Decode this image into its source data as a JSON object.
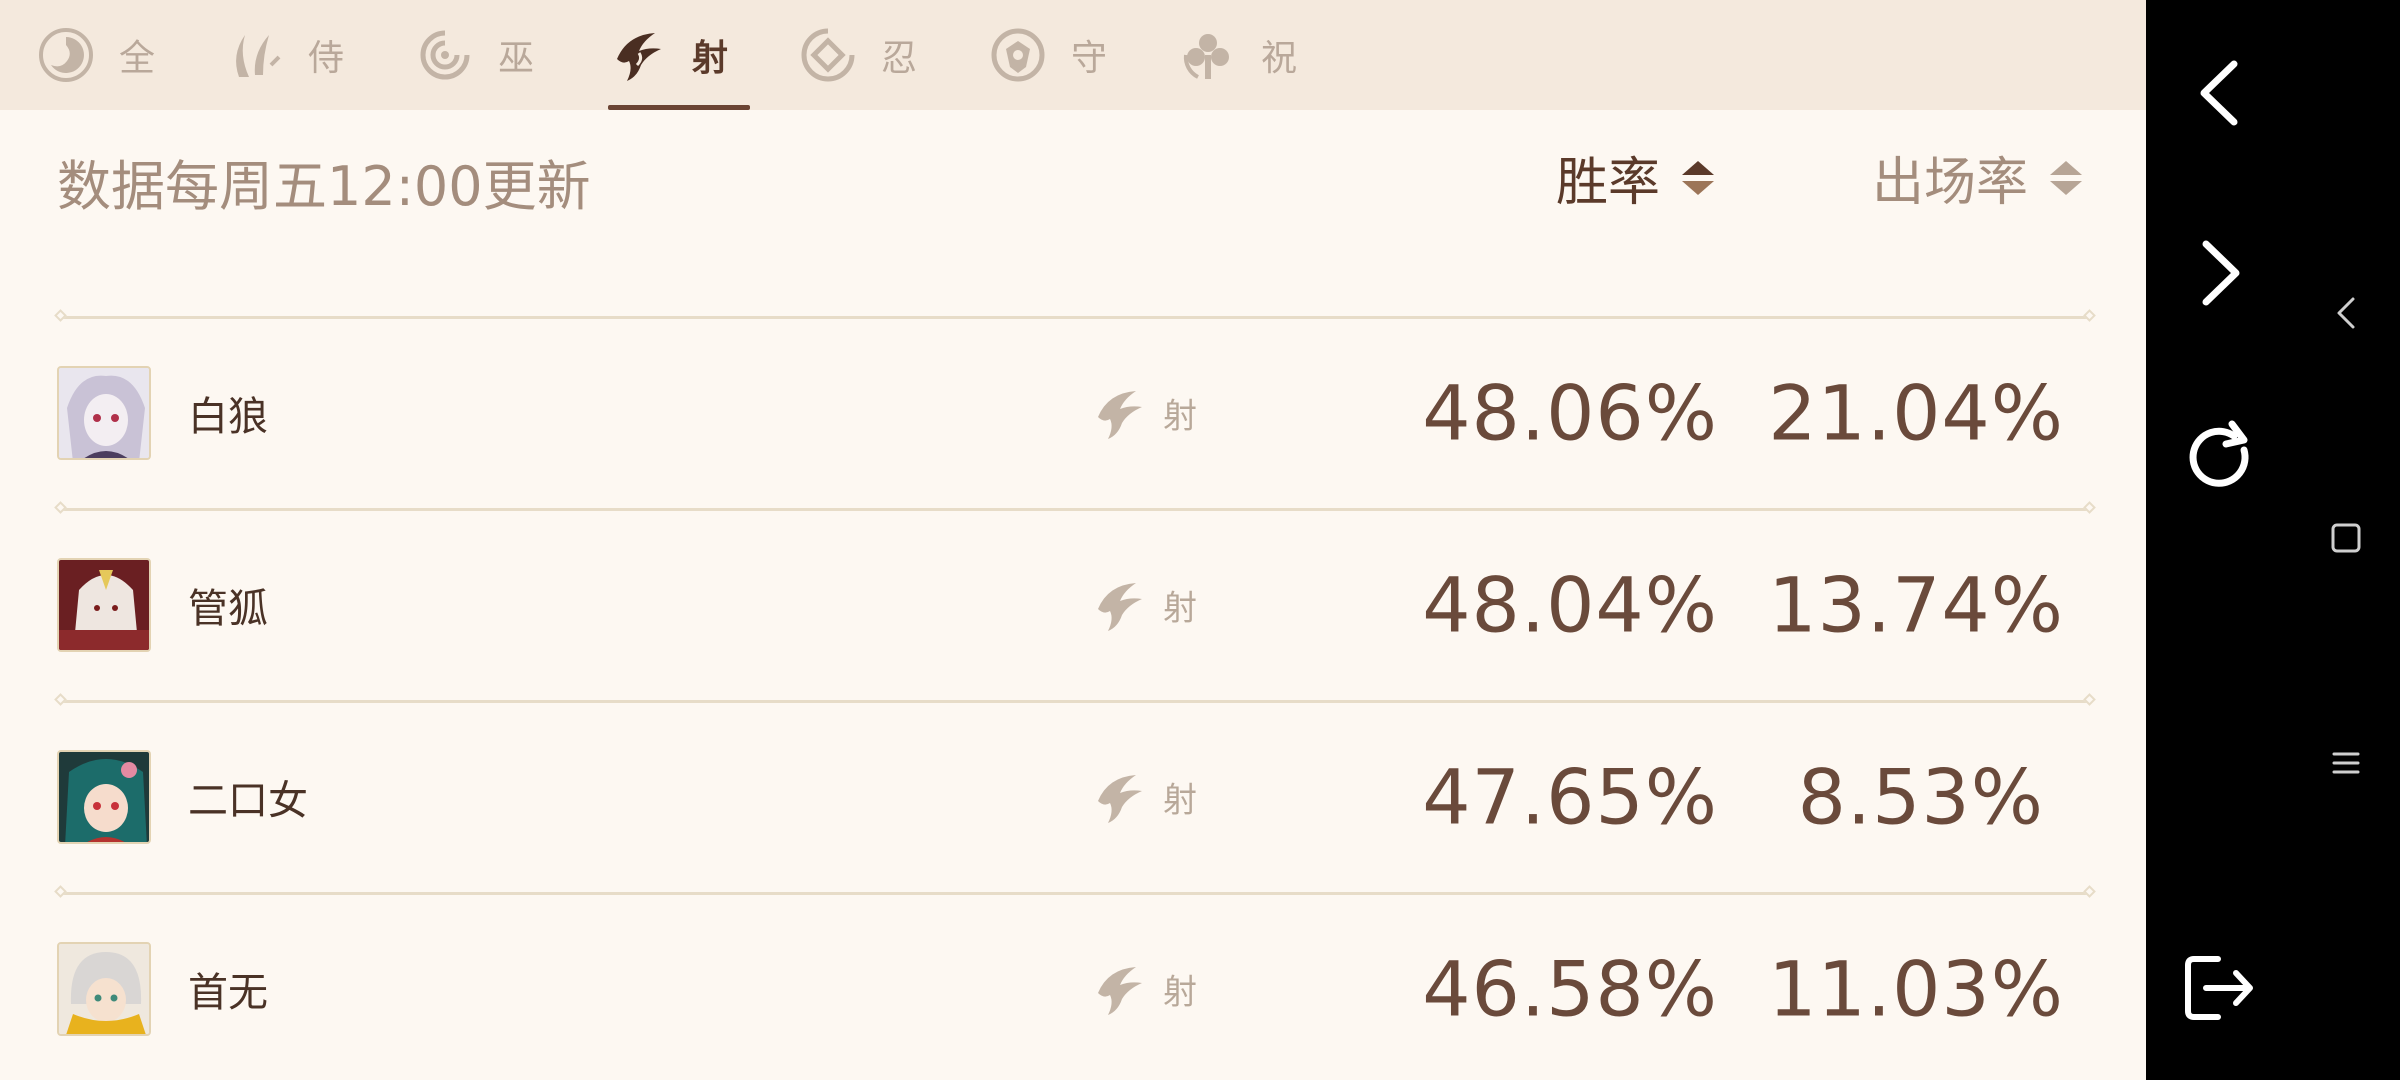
{
  "tabs": [
    {
      "label": "全",
      "icon": "all-icon",
      "active": false
    },
    {
      "label": "侍",
      "icon": "samurai-icon",
      "active": false
    },
    {
      "label": "巫",
      "icon": "mage-icon",
      "active": false
    },
    {
      "label": "射",
      "icon": "archer-icon",
      "active": true
    },
    {
      "label": "忍",
      "icon": "ninja-icon",
      "active": false
    },
    {
      "label": "守",
      "icon": "guard-icon",
      "active": false
    },
    {
      "label": "祝",
      "icon": "support-icon",
      "active": false
    }
  ],
  "header": {
    "update_note": "数据每周五12:00更新",
    "sort_win": "胜率",
    "sort_play": "出场率"
  },
  "rows": [
    {
      "name": "白狼",
      "class": "射",
      "win_rate": "48.06%",
      "play_rate": "21.04%"
    },
    {
      "name": "管狐",
      "class": "射",
      "win_rate": "48.04%",
      "play_rate": "13.74%"
    },
    {
      "name": "二口女",
      "class": "射",
      "win_rate": "47.65%",
      "play_rate": "8.53%"
    },
    {
      "name": "首无",
      "class": "射",
      "win_rate": "46.58%",
      "play_rate": "11.03%"
    }
  ],
  "colors": {
    "background": "#fdf8f2",
    "tab_bar": "#f4e9dd",
    "accent_dark_brown": "#5b3a2a",
    "muted_text": "#a48d7d",
    "divider": "#e7dcc8"
  },
  "navbar": {
    "buttons": [
      "back-icon",
      "forward-icon",
      "reload-icon",
      "exit-icon",
      "nav-back-icon",
      "nav-home-icon",
      "nav-menu-icon"
    ]
  }
}
